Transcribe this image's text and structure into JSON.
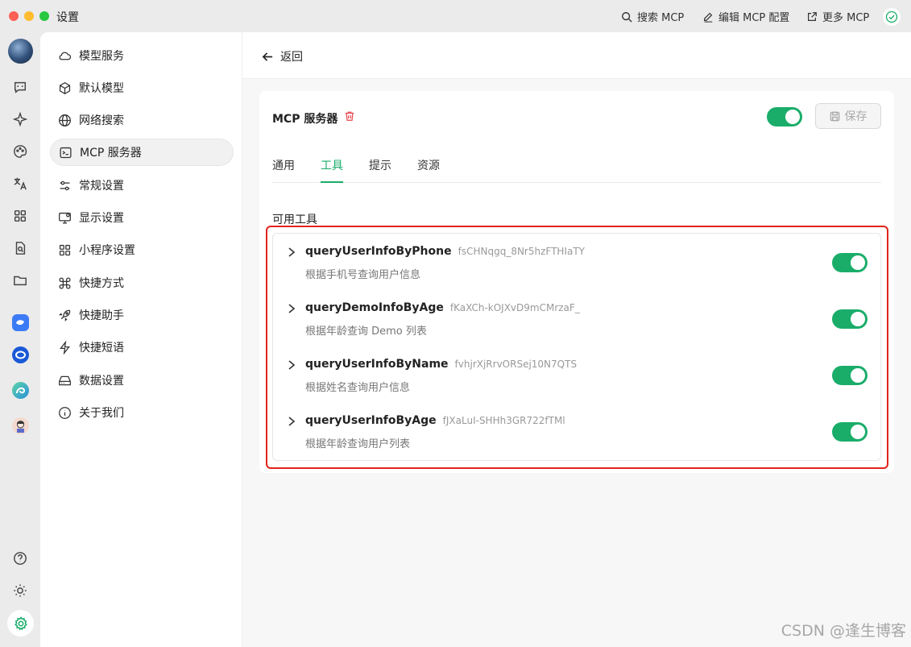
{
  "window": {
    "title": "设置"
  },
  "toolbar": {
    "search_mcp": "搜索 MCP",
    "edit_mcp_config": "编辑 MCP 配置",
    "more_mcp": "更多 MCP"
  },
  "nav": {
    "items": [
      {
        "label": "模型服务",
        "icon": "cloud-icon"
      },
      {
        "label": "默认模型",
        "icon": "cube-icon"
      },
      {
        "label": "网络搜索",
        "icon": "globe-icon"
      },
      {
        "label": "MCP 服务器",
        "icon": "terminal-icon",
        "active": true
      },
      {
        "label": "常规设置",
        "icon": "sliders-icon"
      },
      {
        "label": "显示设置",
        "icon": "monitor-icon"
      },
      {
        "label": "小程序设置",
        "icon": "grid-icon"
      },
      {
        "label": "快捷方式",
        "icon": "command-icon"
      },
      {
        "label": "快捷助手",
        "icon": "rocket-icon"
      },
      {
        "label": "快捷短语",
        "icon": "zap-icon"
      },
      {
        "label": "数据设置",
        "icon": "drive-icon"
      },
      {
        "label": "关于我们",
        "icon": "info-icon"
      }
    ]
  },
  "main": {
    "back_label": "返回",
    "server_title": "MCP 服务器",
    "server_enabled": true,
    "save_label": "保存",
    "tabs": [
      {
        "label": "通用",
        "active": false
      },
      {
        "label": "工具",
        "active": true
      },
      {
        "label": "提示",
        "active": false
      },
      {
        "label": "资源",
        "active": false
      }
    ],
    "section_label": "可用工具",
    "tools": [
      {
        "name": "queryUserInfoByPhone",
        "id": "fsCHNqgq_8Nr5hzFTHIaTY",
        "description": "根据手机号查询用户信息",
        "enabled": true
      },
      {
        "name": "queryDemoInfoByAge",
        "id": "fKaXCh-kOJXvD9mCMrzaF_",
        "description": "根据年龄查询 Demo 列表",
        "enabled": true
      },
      {
        "name": "queryUserInfoByName",
        "id": "fvhjrXjRrvORSej10N7QTS",
        "description": "根据姓名查询用户信息",
        "enabled": true
      },
      {
        "name": "queryUserInfoByAge",
        "id": "fJXaLuI-SHHh3GR722fTMl",
        "description": "根据年龄查询用户列表",
        "enabled": true
      }
    ]
  },
  "colors": {
    "accent": "#1aad6a",
    "highlight_border": "#e2231a",
    "delete": "#e5484d"
  },
  "watermark": "CSDN @逢生博客"
}
